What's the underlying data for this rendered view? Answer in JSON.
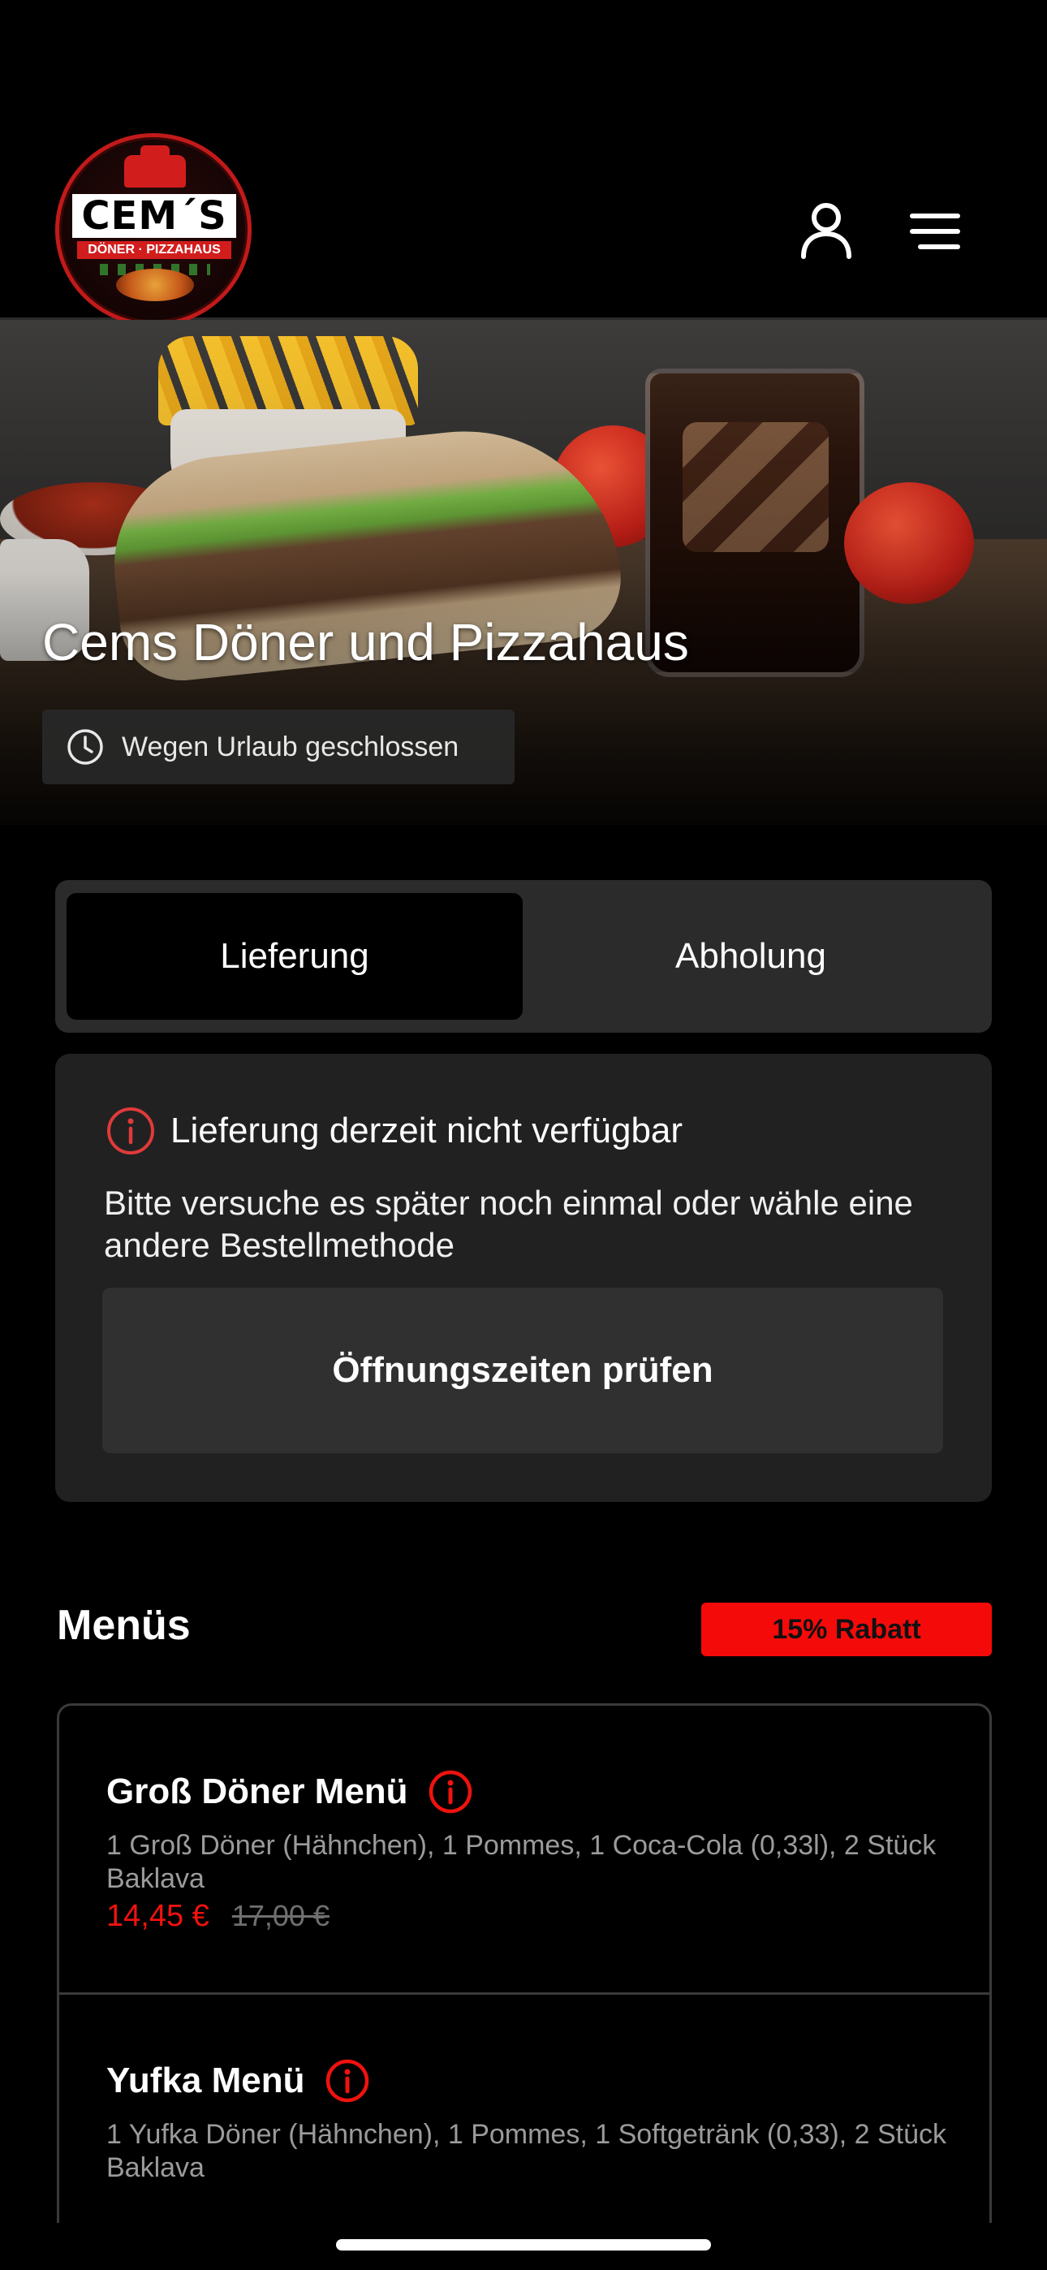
{
  "header": {
    "logo": {
      "title": "CEM´S",
      "subtitle": "DÖNER · PIZZAHAUS"
    },
    "icons": [
      "user-icon",
      "hamburger-menu-icon"
    ]
  },
  "hero": {
    "title": "Cems Döner und Pizzahaus",
    "status": "Wegen Urlaub geschlossen",
    "status_icon": "clock-icon"
  },
  "order_mode": {
    "tabs": [
      {
        "label": "Lieferung",
        "active": true
      },
      {
        "label": "Abholung",
        "active": false
      }
    ]
  },
  "notice": {
    "title": "Lieferung derzeit nicht verfügbar",
    "body": "Bitte versuche es später noch einmal oder wähle eine andere Bestellmethode",
    "button": "Öffnungszeiten prüfen",
    "icon": "info-icon"
  },
  "section": {
    "title": "Menüs",
    "badge": "15% Rabatt"
  },
  "menu_items": [
    {
      "title": "Groß Döner Menü",
      "description": "1 Groß Döner (Hähnchen), 1 Pommes, 1 Coca-Cola (0,33l), 2 Stück Baklava",
      "price": "14,45 €",
      "old_price": "17,00 €"
    },
    {
      "title": "Yufka Menü",
      "description": "1 Yufka Döner (Hähnchen), 1 Pommes, 1 Softgetränk (0,33), 2 Stück Baklava"
    }
  ],
  "colors": {
    "background": "#000000",
    "card": "#212121",
    "segment": "#2b2b2b",
    "accent_red": "#f50a0a",
    "price_red": "#f0120e",
    "muted_text": "#9b9b9b"
  }
}
